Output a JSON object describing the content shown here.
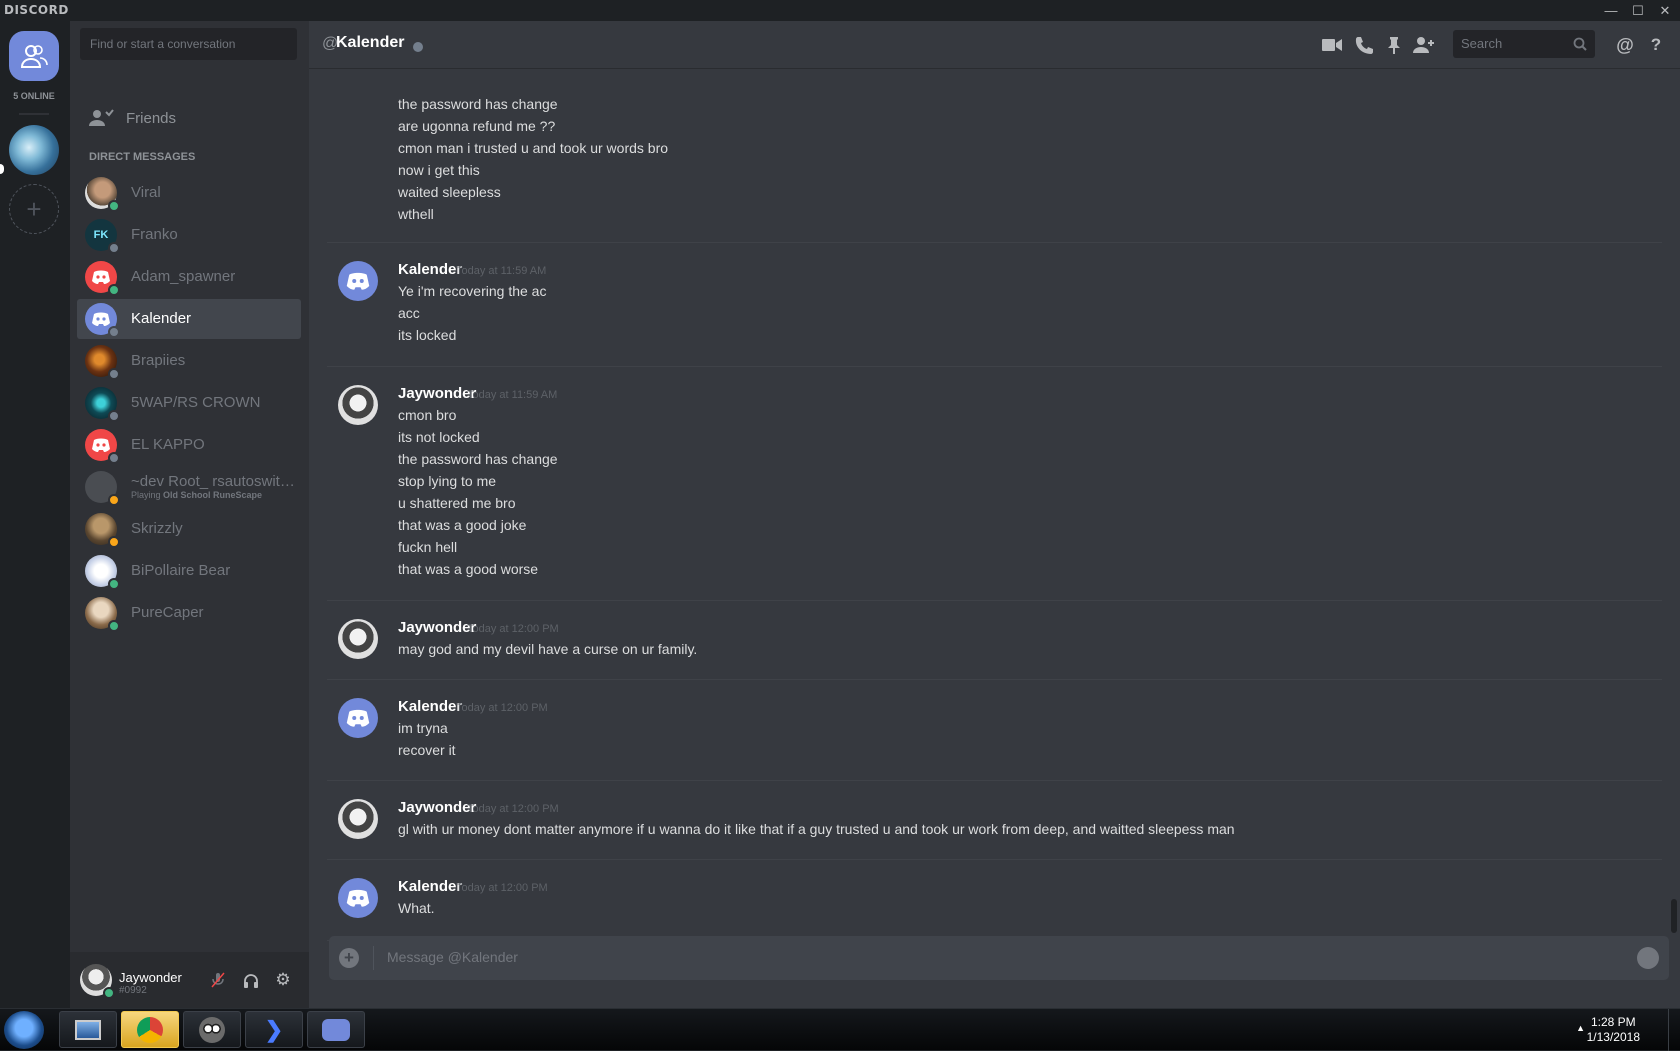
{
  "window": {
    "brand": "DISCORD"
  },
  "guilds": {
    "online_count": "5 ONLINE"
  },
  "sidebar": {
    "search_placeholder": "Find or start a conversation",
    "friends_label": "Friends",
    "dm_header": "DIRECT MESSAGES",
    "dms": [
      {
        "name": "Viral",
        "status": "online"
      },
      {
        "name": "Franko",
        "status": "offline"
      },
      {
        "name": "Adam_spawner",
        "status": "online"
      },
      {
        "name": "Kalender",
        "status": "offline",
        "active": true
      },
      {
        "name": "Brapiies",
        "status": "offline"
      },
      {
        "name": "5WAP/RS CROWN",
        "status": "offline"
      },
      {
        "name": "EL KAPPO",
        "status": "offline"
      },
      {
        "name": "~dev Root_ rsautoswitch...",
        "status": "idle",
        "activity_prefix": "Playing",
        "activity": "Old School RuneScape"
      },
      {
        "name": "Skrizzly",
        "status": "idle"
      },
      {
        "name": "BiPollaire Bear",
        "status": "online"
      },
      {
        "name": "PureCaper",
        "status": "online"
      }
    ]
  },
  "user": {
    "name": "Jaywonder",
    "tag": "#0992"
  },
  "chat": {
    "at": "@",
    "title": "Kalender",
    "search_placeholder": "Search",
    "composer_placeholder": "Message @Kalender",
    "groups": [
      {
        "author": "",
        "time": "",
        "lines": [
          "the password has change",
          "are ugonna refund me ??",
          "cmon man i trusted u and took ur words bro",
          "now i get this",
          "waited sleepless",
          "wthell"
        ]
      },
      {
        "author": "Kalender",
        "time": "Today at 11:59 AM",
        "lines": [
          "Ye i'm recovering the ac",
          "acc",
          "its locked"
        ]
      },
      {
        "author": "Jaywonder",
        "time": "Today at 11:59 AM",
        "lines": [
          "cmon bro",
          "its not locked",
          "the password has change",
          "stop lying to me",
          "u shattered me bro",
          "that was a good joke",
          "fuckn hell",
          "that was a good worse"
        ]
      },
      {
        "author": "Jaywonder",
        "time": "Today at 12:00 PM",
        "lines": [
          "may god and my devil have a curse on ur family."
        ]
      },
      {
        "author": "Kalender",
        "time": "Today at 12:00 PM",
        "lines": [
          "im tryna",
          "recover it"
        ]
      },
      {
        "author": "Jaywonder",
        "time": "Today at 12:00 PM",
        "lines": [
          "gl with ur money dont matter anymore if u wanna do it like that if a guy trusted u and took ur work from deep, and waitted sleepess man"
        ]
      },
      {
        "author": "Kalender",
        "time": "Today at 12:00 PM",
        "lines": [
          "What."
        ]
      }
    ]
  },
  "taskbar": {
    "time": "1:28 PM",
    "date": "1/13/2018"
  },
  "colors": {
    "accent": "#7289da",
    "online": "#43b581",
    "idle": "#faa61a",
    "offline": "#747f8d",
    "dnd_red": "#f04747"
  }
}
